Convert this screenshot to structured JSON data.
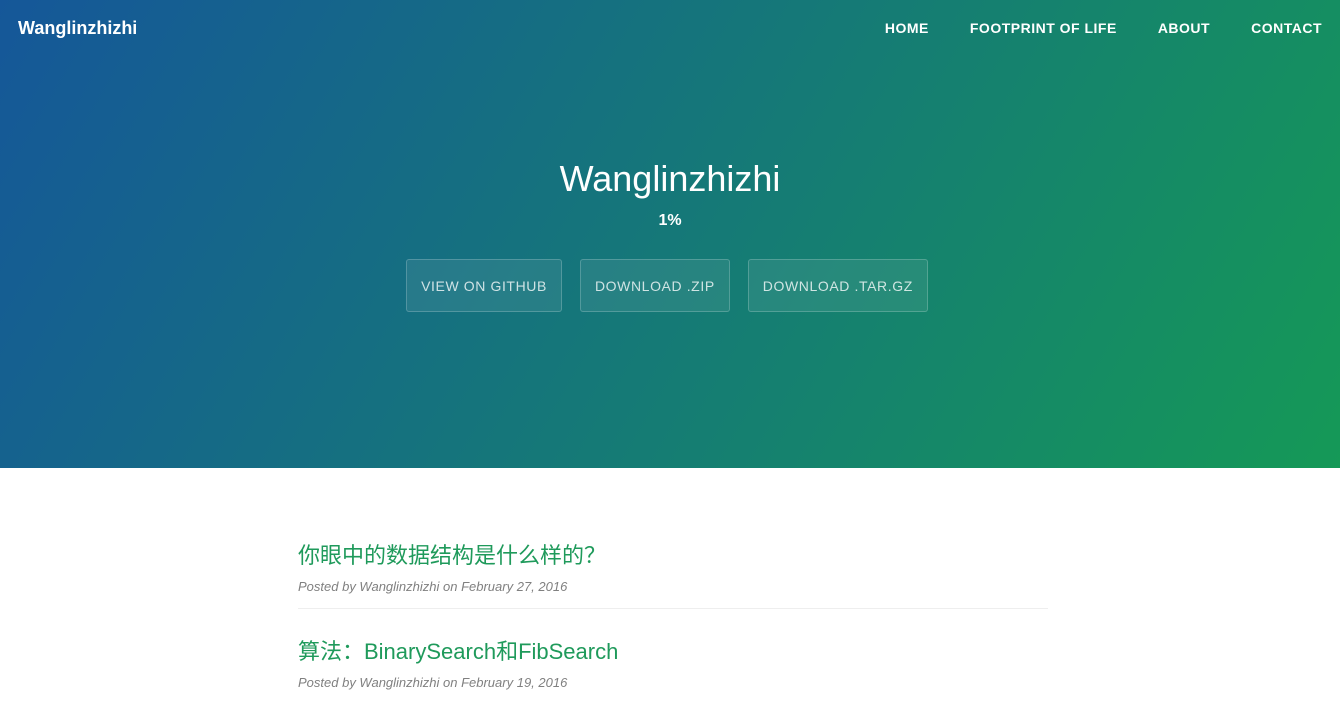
{
  "navbar": {
    "brand": "Wanglinzhizhi",
    "links": [
      {
        "label": "HOME"
      },
      {
        "label": "FOOTPRINT OF LIFE"
      },
      {
        "label": "ABOUT"
      },
      {
        "label": "CONTACT"
      }
    ]
  },
  "hero": {
    "title": "Wanglinzhizhi",
    "tagline": "1%",
    "buttons": [
      {
        "label": "VIEW ON GITHUB"
      },
      {
        "label": "DOWNLOAD .ZIP"
      },
      {
        "label": "DOWNLOAD .TAR.GZ"
      }
    ],
    "gradient_start": "#155799",
    "gradient_end": "#159957"
  },
  "posts": [
    {
      "title": "你眼中的数据结构是什么样的？",
      "meta": "Posted by Wanglinzhizhi on February 27, 2016"
    },
    {
      "title": "算法：BinarySearch和FibSearch",
      "meta": "Posted by Wanglinzhizhi on February 19, 2016"
    }
  ],
  "colors": {
    "link_green": "#1f9a5b",
    "meta_gray": "#808080"
  }
}
